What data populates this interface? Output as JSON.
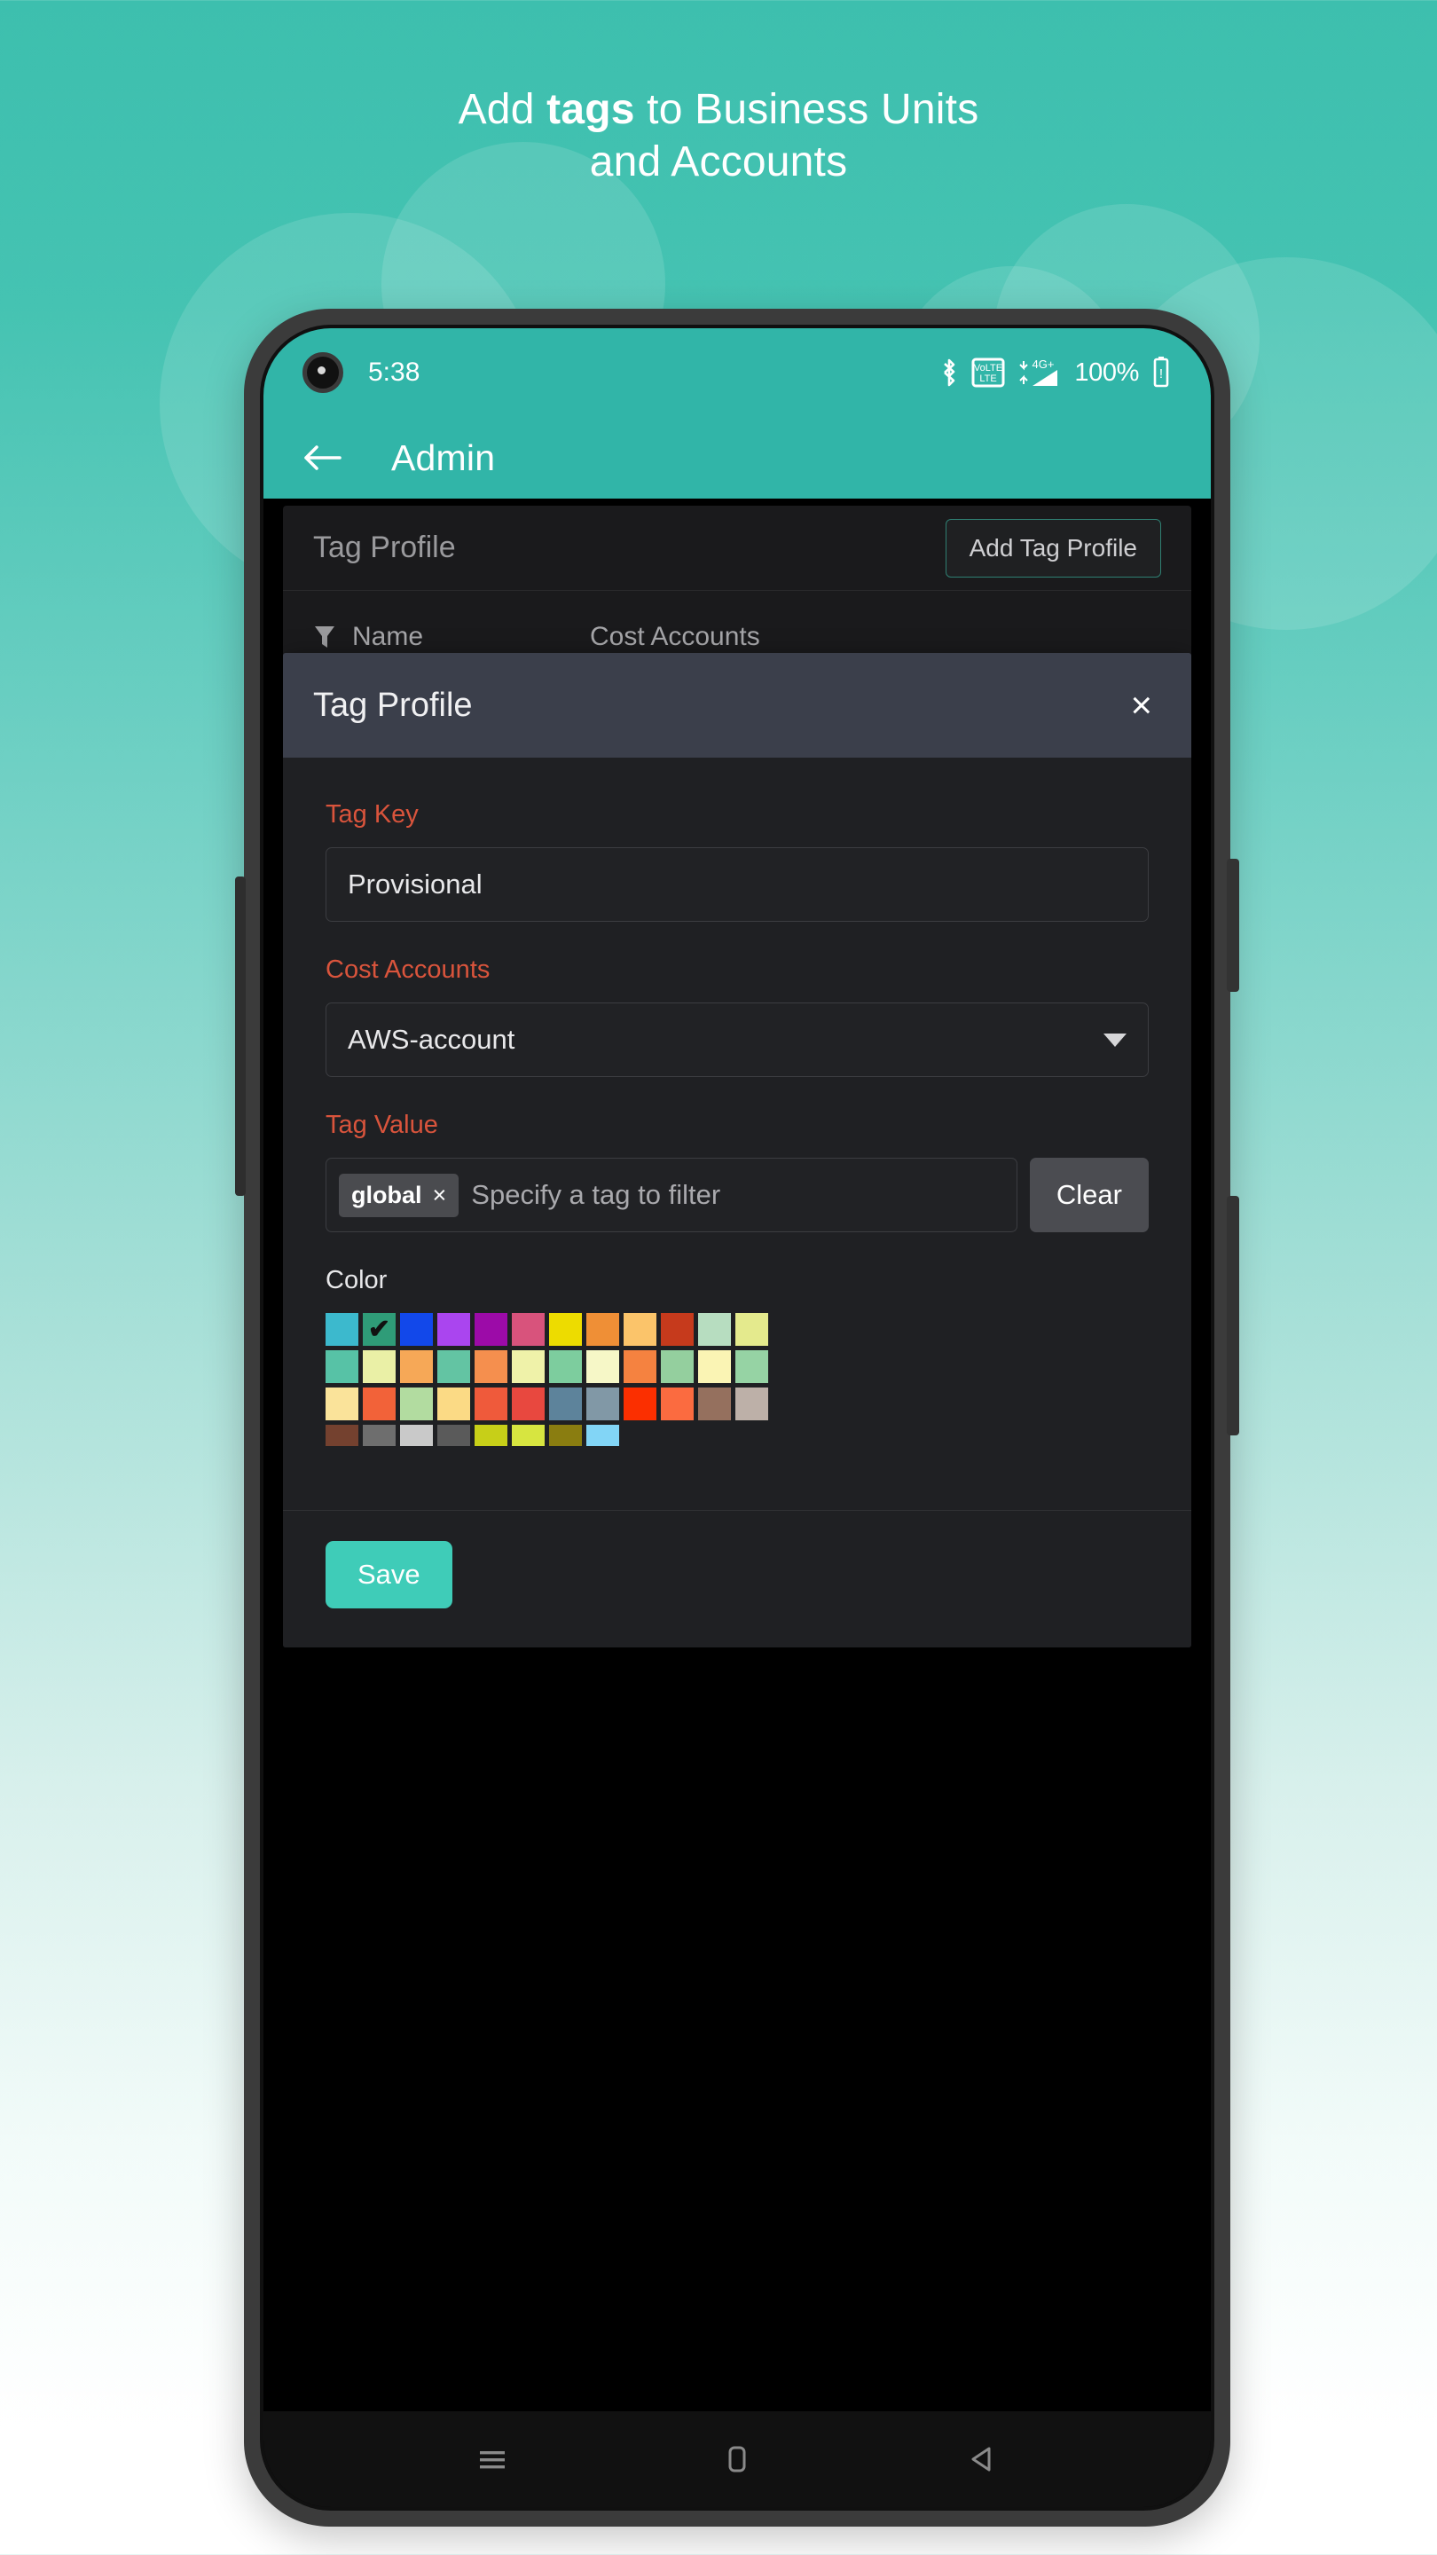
{
  "promo": {
    "headline_before": "Add ",
    "headline_bold": "tags",
    "headline_after": " to Business Units",
    "headline_line2": "and Accounts"
  },
  "status_bar": {
    "time": "5:38",
    "battery_percent": "100%",
    "icons": [
      "bluetooth-icon",
      "volte-icon",
      "signal-4g-plus-icon",
      "battery-icon"
    ],
    "network_label": "4G+",
    "volte_label": "VoLTE"
  },
  "app_bar": {
    "back_label": "back-arrow",
    "title": "Admin"
  },
  "background_panel": {
    "title": "Tag Profile",
    "add_button": "Add Tag Profile",
    "columns": [
      "Name",
      "Cost Accounts"
    ]
  },
  "modal": {
    "title": "Tag Profile",
    "close_label": "×",
    "fields": {
      "tag_key": {
        "label": "Tag Key",
        "value": "Provisional"
      },
      "cost_accounts": {
        "label": "Cost Accounts",
        "value": "AWS-account"
      },
      "tag_value": {
        "label": "Tag Value",
        "chip": "global",
        "chip_remove": "×",
        "placeholder": "Specify a tag to filter",
        "clear_label": "Clear"
      },
      "color": {
        "label": "Color",
        "selected_index": 1,
        "check_glyph": "✔"
      }
    },
    "save_label": "Save"
  },
  "palette": {
    "row1": [
      "#3cb9cd",
      "#2f9c78",
      "#1248ea",
      "#aa45ef",
      "#9c0ba8",
      "#d8537c",
      "#eddc00",
      "#ef8f36",
      "#fbc46a",
      "#c63a1c",
      "#b7ddc0",
      "#e4ea8d"
    ],
    "row2": [
      "#57c2a6",
      "#eaf0a6",
      "#f6a857",
      "#63c4a3",
      "#f58f4e",
      "#eff2a9",
      "#7dcd9e",
      "#f6f7c7",
      "#f58240",
      "#94cf9e",
      "#faf4b4",
      "#96d3a4"
    ],
    "row3": [
      "#fae39a",
      "#f26239",
      "#b2dca0",
      "#fbda85",
      "#ef5a3b",
      "#e8483f",
      "#5d839b",
      "#8198a6",
      "#fb2f00",
      "#fb6b40",
      "#95705e",
      "#bdb0a8"
    ],
    "row4": [
      "#74412f",
      "#6e6e6e",
      "#c9c9c9",
      "#5a5a5a",
      "#c7cf18",
      "#d7e540",
      "#8a7d10",
      "#82d5f6"
    ]
  },
  "nav_bar": {
    "items": [
      "recents-icon",
      "home-icon",
      "back-icon"
    ]
  },
  "theme": {
    "accent_teal": "#31b5a8",
    "save_teal": "#3fccb8",
    "label_red": "#d9543c",
    "modal_header": "#3b3f4b"
  }
}
